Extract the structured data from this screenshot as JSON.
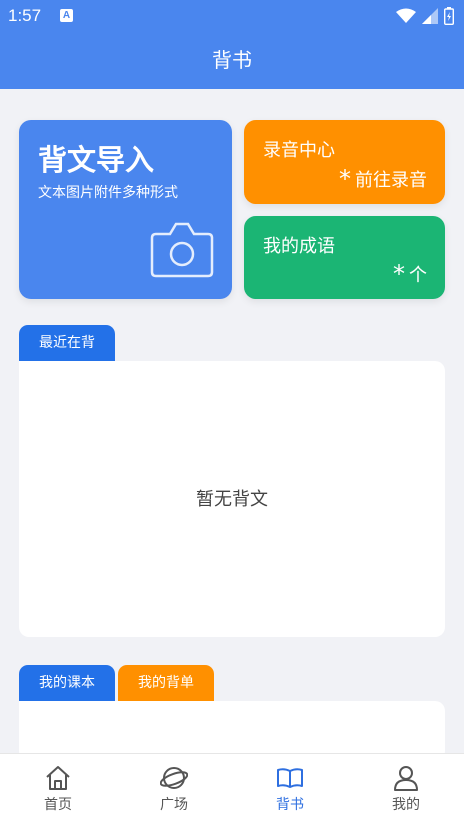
{
  "status_bar": {
    "time": "1:57",
    "notification_label": "A"
  },
  "app_bar": {
    "title": "背书"
  },
  "cards": {
    "import": {
      "title": "背文导入",
      "subtitle": "文本图片附件多种形式"
    },
    "record": {
      "title": "录音中心",
      "action_symbol": "*",
      "action": "前往录音"
    },
    "idiom": {
      "title": "我的成语",
      "action_symbol": "*",
      "action": "个"
    }
  },
  "recent": {
    "tab_label": "最近在背",
    "empty_text": "暂无背文"
  },
  "bottom_tabs": {
    "course": "我的课本",
    "list": "我的背单"
  },
  "nav": [
    {
      "label": "首页",
      "icon": "home-icon"
    },
    {
      "label": "广场",
      "icon": "planet-icon"
    },
    {
      "label": "背书",
      "icon": "book-icon"
    },
    {
      "label": "我的",
      "icon": "user-icon"
    }
  ],
  "colors": {
    "primary": "#4a86ee",
    "orange": "#ff9000",
    "green": "#1bb574",
    "tab_blue": "#2371e8",
    "active_nav": "#2e6fe0"
  }
}
